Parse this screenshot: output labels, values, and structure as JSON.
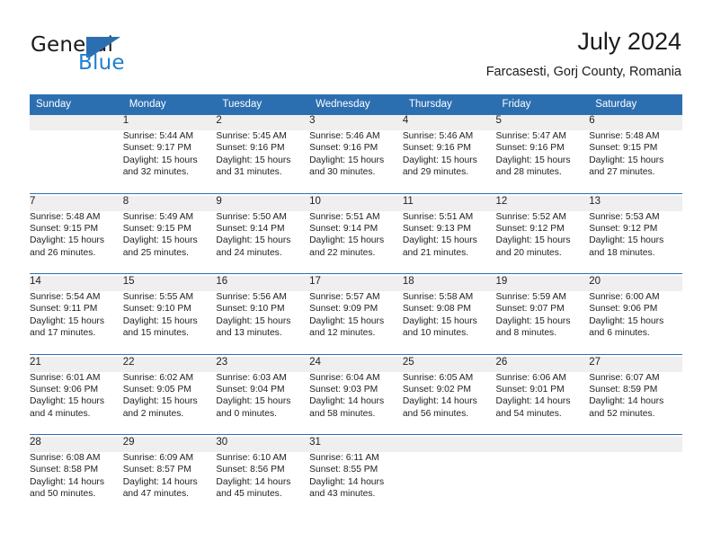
{
  "brand": {
    "name_part1": "General",
    "name_part2": "Blue",
    "flag_icon": "flag-icon",
    "accent_color": "#2c6fb0",
    "text_color": "#1f7fd0"
  },
  "header": {
    "title": "July 2024",
    "location": "Farcasesti, Gorj County, Romania"
  },
  "theme": {
    "header_blue": "#2c6fb0",
    "daynum_gray": "#efefef",
    "body_white": "#ffffff",
    "text": "#222222"
  },
  "calendar": {
    "weekday_headers": [
      "Sunday",
      "Monday",
      "Tuesday",
      "Wednesday",
      "Thursday",
      "Friday",
      "Saturday"
    ],
    "weeks": [
      [
        {
          "day": "",
          "sunrise": "",
          "sunset": "",
          "daylight1": "",
          "daylight2": ""
        },
        {
          "day": "1",
          "sunrise": "Sunrise: 5:44 AM",
          "sunset": "Sunset: 9:17 PM",
          "daylight1": "Daylight: 15 hours",
          "daylight2": "and 32 minutes."
        },
        {
          "day": "2",
          "sunrise": "Sunrise: 5:45 AM",
          "sunset": "Sunset: 9:16 PM",
          "daylight1": "Daylight: 15 hours",
          "daylight2": "and 31 minutes."
        },
        {
          "day": "3",
          "sunrise": "Sunrise: 5:46 AM",
          "sunset": "Sunset: 9:16 PM",
          "daylight1": "Daylight: 15 hours",
          "daylight2": "and 30 minutes."
        },
        {
          "day": "4",
          "sunrise": "Sunrise: 5:46 AM",
          "sunset": "Sunset: 9:16 PM",
          "daylight1": "Daylight: 15 hours",
          "daylight2": "and 29 minutes."
        },
        {
          "day": "5",
          "sunrise": "Sunrise: 5:47 AM",
          "sunset": "Sunset: 9:16 PM",
          "daylight1": "Daylight: 15 hours",
          "daylight2": "and 28 minutes."
        },
        {
          "day": "6",
          "sunrise": "Sunrise: 5:48 AM",
          "sunset": "Sunset: 9:15 PM",
          "daylight1": "Daylight: 15 hours",
          "daylight2": "and 27 minutes."
        }
      ],
      [
        {
          "day": "7",
          "sunrise": "Sunrise: 5:48 AM",
          "sunset": "Sunset: 9:15 PM",
          "daylight1": "Daylight: 15 hours",
          "daylight2": "and 26 minutes."
        },
        {
          "day": "8",
          "sunrise": "Sunrise: 5:49 AM",
          "sunset": "Sunset: 9:15 PM",
          "daylight1": "Daylight: 15 hours",
          "daylight2": "and 25 minutes."
        },
        {
          "day": "9",
          "sunrise": "Sunrise: 5:50 AM",
          "sunset": "Sunset: 9:14 PM",
          "daylight1": "Daylight: 15 hours",
          "daylight2": "and 24 minutes."
        },
        {
          "day": "10",
          "sunrise": "Sunrise: 5:51 AM",
          "sunset": "Sunset: 9:14 PM",
          "daylight1": "Daylight: 15 hours",
          "daylight2": "and 22 minutes."
        },
        {
          "day": "11",
          "sunrise": "Sunrise: 5:51 AM",
          "sunset": "Sunset: 9:13 PM",
          "daylight1": "Daylight: 15 hours",
          "daylight2": "and 21 minutes."
        },
        {
          "day": "12",
          "sunrise": "Sunrise: 5:52 AM",
          "sunset": "Sunset: 9:12 PM",
          "daylight1": "Daylight: 15 hours",
          "daylight2": "and 20 minutes."
        },
        {
          "day": "13",
          "sunrise": "Sunrise: 5:53 AM",
          "sunset": "Sunset: 9:12 PM",
          "daylight1": "Daylight: 15 hours",
          "daylight2": "and 18 minutes."
        }
      ],
      [
        {
          "day": "14",
          "sunrise": "Sunrise: 5:54 AM",
          "sunset": "Sunset: 9:11 PM",
          "daylight1": "Daylight: 15 hours",
          "daylight2": "and 17 minutes."
        },
        {
          "day": "15",
          "sunrise": "Sunrise: 5:55 AM",
          "sunset": "Sunset: 9:10 PM",
          "daylight1": "Daylight: 15 hours",
          "daylight2": "and 15 minutes."
        },
        {
          "day": "16",
          "sunrise": "Sunrise: 5:56 AM",
          "sunset": "Sunset: 9:10 PM",
          "daylight1": "Daylight: 15 hours",
          "daylight2": "and 13 minutes."
        },
        {
          "day": "17",
          "sunrise": "Sunrise: 5:57 AM",
          "sunset": "Sunset: 9:09 PM",
          "daylight1": "Daylight: 15 hours",
          "daylight2": "and 12 minutes."
        },
        {
          "day": "18",
          "sunrise": "Sunrise: 5:58 AM",
          "sunset": "Sunset: 9:08 PM",
          "daylight1": "Daylight: 15 hours",
          "daylight2": "and 10 minutes."
        },
        {
          "day": "19",
          "sunrise": "Sunrise: 5:59 AM",
          "sunset": "Sunset: 9:07 PM",
          "daylight1": "Daylight: 15 hours",
          "daylight2": "and 8 minutes."
        },
        {
          "day": "20",
          "sunrise": "Sunrise: 6:00 AM",
          "sunset": "Sunset: 9:06 PM",
          "daylight1": "Daylight: 15 hours",
          "daylight2": "and 6 minutes."
        }
      ],
      [
        {
          "day": "21",
          "sunrise": "Sunrise: 6:01 AM",
          "sunset": "Sunset: 9:06 PM",
          "daylight1": "Daylight: 15 hours",
          "daylight2": "and 4 minutes."
        },
        {
          "day": "22",
          "sunrise": "Sunrise: 6:02 AM",
          "sunset": "Sunset: 9:05 PM",
          "daylight1": "Daylight: 15 hours",
          "daylight2": "and 2 minutes."
        },
        {
          "day": "23",
          "sunrise": "Sunrise: 6:03 AM",
          "sunset": "Sunset: 9:04 PM",
          "daylight1": "Daylight: 15 hours",
          "daylight2": "and 0 minutes."
        },
        {
          "day": "24",
          "sunrise": "Sunrise: 6:04 AM",
          "sunset": "Sunset: 9:03 PM",
          "daylight1": "Daylight: 14 hours",
          "daylight2": "and 58 minutes."
        },
        {
          "day": "25",
          "sunrise": "Sunrise: 6:05 AM",
          "sunset": "Sunset: 9:02 PM",
          "daylight1": "Daylight: 14 hours",
          "daylight2": "and 56 minutes."
        },
        {
          "day": "26",
          "sunrise": "Sunrise: 6:06 AM",
          "sunset": "Sunset: 9:01 PM",
          "daylight1": "Daylight: 14 hours",
          "daylight2": "and 54 minutes."
        },
        {
          "day": "27",
          "sunrise": "Sunrise: 6:07 AM",
          "sunset": "Sunset: 8:59 PM",
          "daylight1": "Daylight: 14 hours",
          "daylight2": "and 52 minutes."
        }
      ],
      [
        {
          "day": "28",
          "sunrise": "Sunrise: 6:08 AM",
          "sunset": "Sunset: 8:58 PM",
          "daylight1": "Daylight: 14 hours",
          "daylight2": "and 50 minutes."
        },
        {
          "day": "29",
          "sunrise": "Sunrise: 6:09 AM",
          "sunset": "Sunset: 8:57 PM",
          "daylight1": "Daylight: 14 hours",
          "daylight2": "and 47 minutes."
        },
        {
          "day": "30",
          "sunrise": "Sunrise: 6:10 AM",
          "sunset": "Sunset: 8:56 PM",
          "daylight1": "Daylight: 14 hours",
          "daylight2": "and 45 minutes."
        },
        {
          "day": "31",
          "sunrise": "Sunrise: 6:11 AM",
          "sunset": "Sunset: 8:55 PM",
          "daylight1": "Daylight: 14 hours",
          "daylight2": "and 43 minutes."
        },
        {
          "day": "",
          "sunrise": "",
          "sunset": "",
          "daylight1": "",
          "daylight2": ""
        },
        {
          "day": "",
          "sunrise": "",
          "sunset": "",
          "daylight1": "",
          "daylight2": ""
        },
        {
          "day": "",
          "sunrise": "",
          "sunset": "",
          "daylight1": "",
          "daylight2": ""
        }
      ]
    ]
  }
}
